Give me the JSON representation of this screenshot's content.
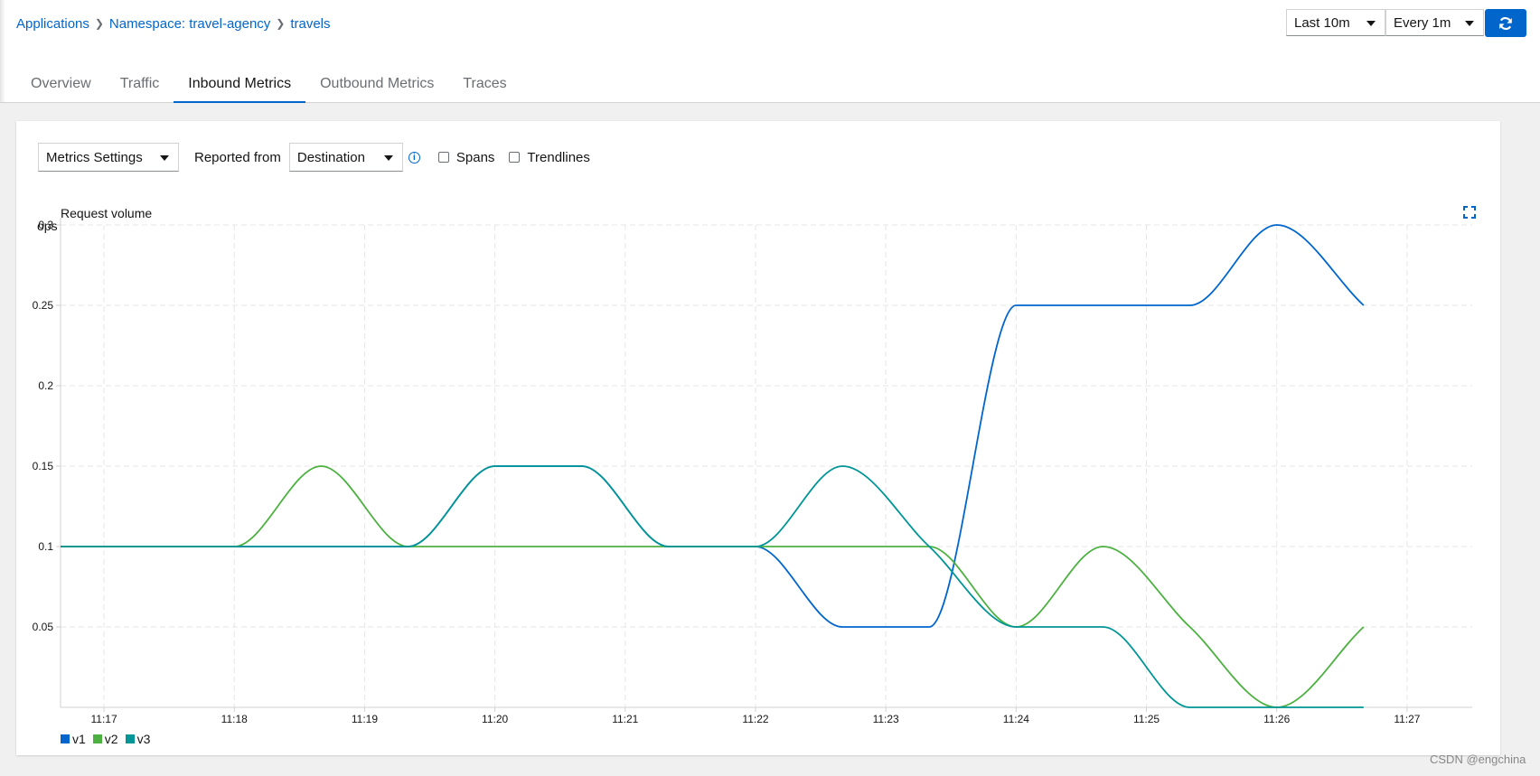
{
  "breadcrumb": {
    "items": [
      "Applications",
      "Namespace: travel-agency",
      "travels"
    ]
  },
  "controls": {
    "duration": "Last 10m",
    "refresh_interval": "Every 1m",
    "refresh_icon": "sync-icon"
  },
  "tabs": [
    {
      "label": "Overview",
      "active": false
    },
    {
      "label": "Traffic",
      "active": false
    },
    {
      "label": "Inbound Metrics",
      "active": true
    },
    {
      "label": "Outbound Metrics",
      "active": false
    },
    {
      "label": "Traces",
      "active": false
    }
  ],
  "toolbar": {
    "metrics_settings": "Metrics Settings",
    "reported_from_label": "Reported from",
    "reported_from_value": "Destination",
    "spans_label": "Spans",
    "trendlines_label": "Trendlines"
  },
  "chart_data": {
    "type": "line",
    "title": "Request volume",
    "ylabel": "ops",
    "xlabel": "",
    "x_ticks": [
      "11:17",
      "11:18",
      "11:19",
      "11:20",
      "11:21",
      "11:22",
      "11:23",
      "11:24",
      "11:25",
      "11:26",
      "11:27"
    ],
    "y_ticks": [
      0.05,
      0.1,
      0.15,
      0.2,
      0.25,
      0.3
    ],
    "ylim": [
      0,
      0.3
    ],
    "xlim": [
      "11:16:40",
      "11:27:30"
    ],
    "grid": true,
    "legend_position": "bottom-left",
    "x": [
      "11:16:40",
      "11:18:00",
      "11:18:40",
      "11:19:20",
      "11:20:00",
      "11:20:40",
      "11:21:20",
      "11:22:00",
      "11:22:40",
      "11:23:20",
      "11:24:00",
      "11:24:40",
      "11:25:20",
      "11:26:00",
      "11:26:40"
    ],
    "series": [
      {
        "name": "v1",
        "color": "#0066cc",
        "values": [
          0.1,
          0.1,
          0.1,
          0.1,
          0.15,
          0.15,
          0.1,
          0.1,
          0.05,
          0.05,
          0.25,
          0.25,
          0.25,
          0.3,
          0.25
        ]
      },
      {
        "name": "v2",
        "color": "#4cb140",
        "values": [
          0.1,
          0.1,
          0.15,
          0.1,
          0.1,
          0.1,
          0.1,
          0.1,
          0.1,
          0.1,
          0.05,
          0.1,
          0.05,
          0.0,
          0.05
        ]
      },
      {
        "name": "v3",
        "color": "#009596",
        "values": [
          0.1,
          0.1,
          0.1,
          0.1,
          0.15,
          0.15,
          0.1,
          0.1,
          0.15,
          0.1,
          0.05,
          0.05,
          0.0,
          0.0,
          0.0
        ]
      }
    ]
  },
  "watermark": "CSDN @engchina"
}
